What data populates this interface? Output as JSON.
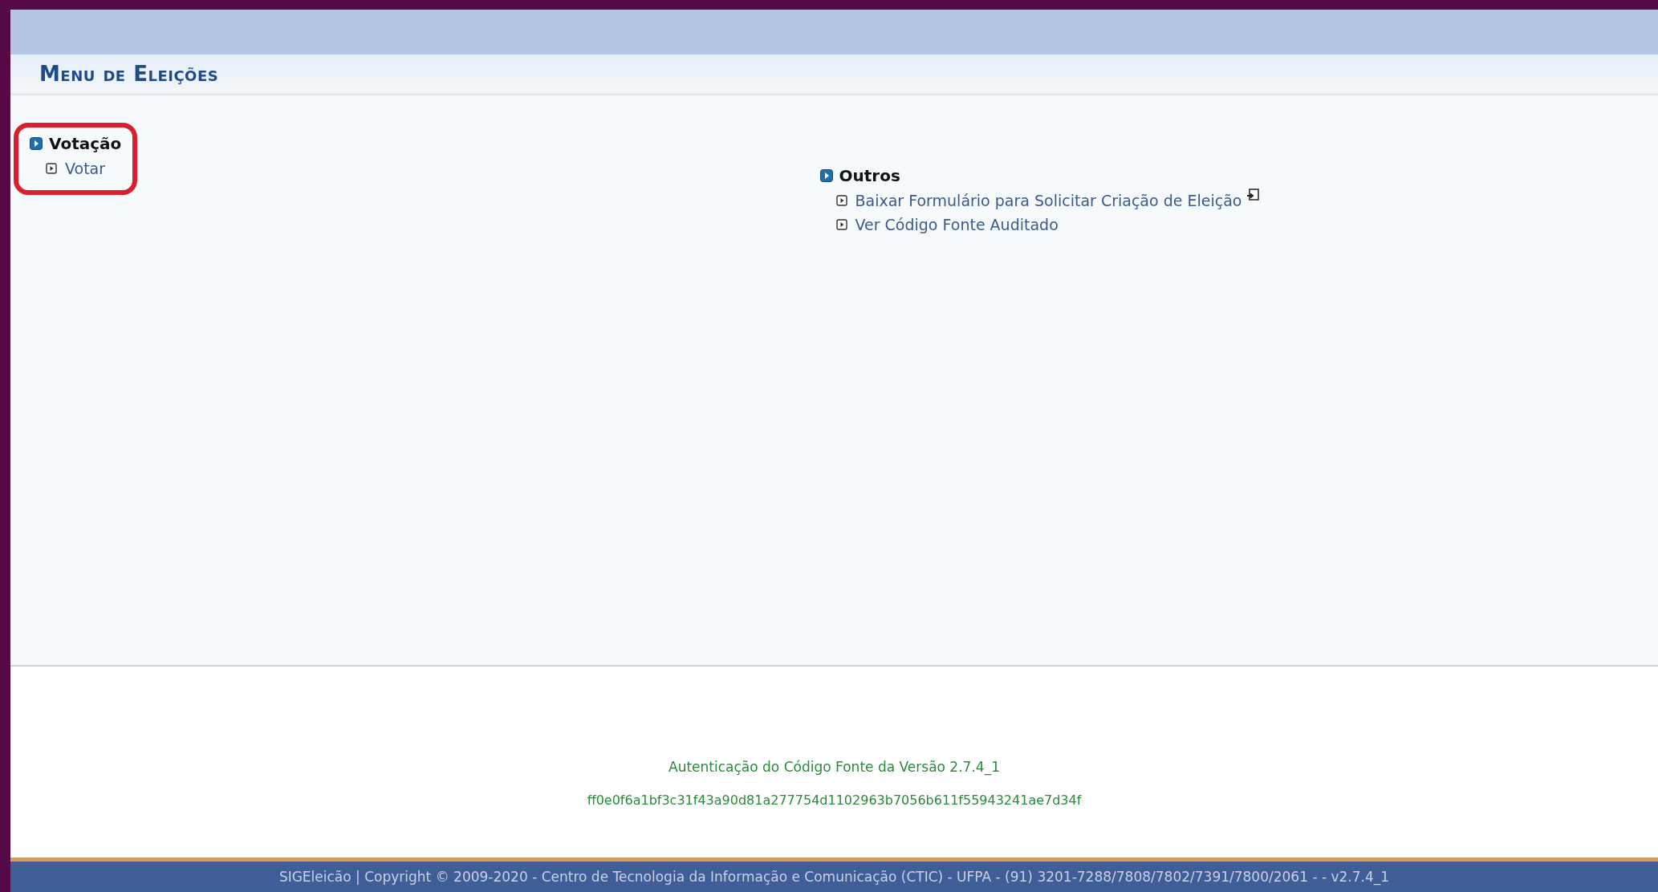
{
  "header": {
    "title": "Menu de Eleições"
  },
  "sections": [
    {
      "title": "Votação",
      "highlighted": true,
      "links": [
        {
          "label": "Votar",
          "external": false
        }
      ]
    },
    {
      "title": "Outros",
      "highlighted": false,
      "links": [
        {
          "label": "Baixar Formulário para Solicitar Criação de Eleição",
          "external": true
        },
        {
          "label": "Ver Código Fonte Auditado",
          "external": false
        }
      ]
    }
  ],
  "footer": {
    "auth_label": "Autenticação do Código Fonte da Versão 2.7.4_1",
    "hash": "ff0e0f6a1bf3c31f43a90d81a277754d1102963b7056b611f55943241ae7d34f"
  },
  "status_bar": {
    "text": "SIGEleicão | Copyright © 2009-2020 - Centro de Tecnologia da Informação e Comunicação (CTIC) - UFPA - (91) 3201-7288/7808/7802/7391/7800/2061 - - v2.7.4_1"
  }
}
